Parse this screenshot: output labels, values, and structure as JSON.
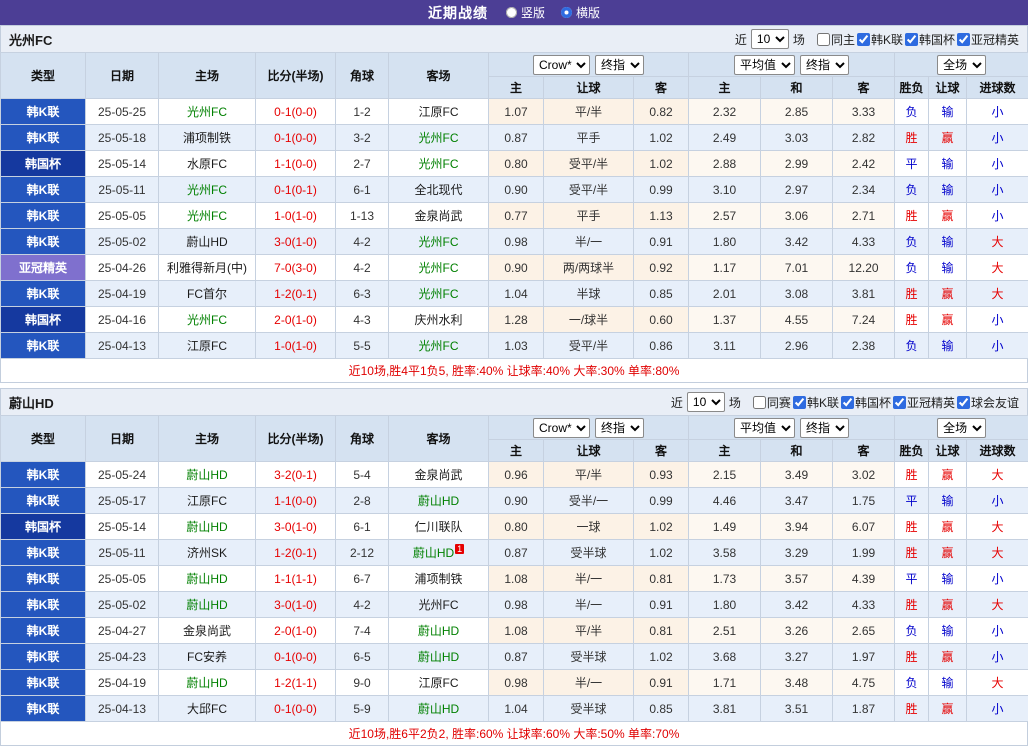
{
  "top_bar": {
    "title": "近期战绩",
    "radio_vertical": "竖版",
    "radio_horizontal": "横版",
    "selected": "横版"
  },
  "labels": {
    "near": "近",
    "count": "10",
    "matches": "场"
  },
  "table_header": {
    "col_type": "类型",
    "col_date": "日期",
    "col_home": "主场",
    "col_score": "比分(半场)",
    "col_corner": "角球",
    "col_away": "客场",
    "odds_source_select": "Crow*",
    "odds_time_select": "终指",
    "avg_select": "平均值",
    "avg_time_select": "终指",
    "scope_select": "全场",
    "sub_home": "主",
    "sub_handicap": "让球",
    "sub_away": "客",
    "sub_avg_home": "主",
    "sub_avg_draw": "和",
    "sub_avg_away": "客",
    "sub_result": "胜负",
    "sub_handicap_result": "让球",
    "sub_goals": "进球数"
  },
  "type_colors": {
    "韩K联": "#2456be",
    "韩国杯": "#15399f",
    "亚冠精英": "#7f70ce"
  },
  "colors": {
    "topbar": "#4c3e95",
    "subject_team": "#008000",
    "score": "#e60000",
    "win_text": "#e60000",
    "loss_text": "#0000cc"
  },
  "sections": [
    {
      "team": "光州FC",
      "filters": [
        {
          "label": "同主",
          "checked": false
        },
        {
          "label": "韩K联",
          "checked": true
        },
        {
          "label": "韩国杯",
          "checked": true
        },
        {
          "label": "亚冠精英",
          "checked": true
        }
      ],
      "rows": [
        {
          "type": "韩K联",
          "date": "25-05-25",
          "home": "光州FC",
          "home_subject": true,
          "score": "0-1(0-0)",
          "corner": "1-2",
          "away": "江原FC",
          "odds": [
            "1.07",
            "平/半",
            "0.82"
          ],
          "avg": [
            "2.32",
            "2.85",
            "3.33"
          ],
          "result": [
            "负",
            "输",
            "小"
          ]
        },
        {
          "type": "韩K联",
          "date": "25-05-18",
          "home": "浦项制铁",
          "score": "0-1(0-0)",
          "corner": "3-2",
          "away": "光州FC",
          "away_subject": true,
          "odds": [
            "0.87",
            "平手",
            "1.02"
          ],
          "avg": [
            "2.49",
            "3.03",
            "2.82"
          ],
          "result": [
            "胜",
            "赢",
            "小"
          ]
        },
        {
          "type": "韩国杯",
          "date": "25-05-14",
          "home": "水原FC",
          "score": "1-1(0-0)",
          "corner": "2-7",
          "away": "光州FC",
          "away_subject": true,
          "odds": [
            "0.80",
            "受平/半",
            "1.02"
          ],
          "avg": [
            "2.88",
            "2.99",
            "2.42"
          ],
          "result": [
            "平",
            "输",
            "小"
          ]
        },
        {
          "type": "韩K联",
          "date": "25-05-11",
          "home": "光州FC",
          "home_subject": true,
          "score": "0-1(0-1)",
          "corner": "6-1",
          "away": "全北现代",
          "odds": [
            "0.90",
            "受平/半",
            "0.99"
          ],
          "avg": [
            "3.10",
            "2.97",
            "2.34"
          ],
          "result": [
            "负",
            "输",
            "小"
          ]
        },
        {
          "type": "韩K联",
          "date": "25-05-05",
          "home": "光州FC",
          "home_subject": true,
          "score": "1-0(1-0)",
          "corner": "1-13",
          "away": "金泉尚武",
          "odds": [
            "0.77",
            "平手",
            "1.13"
          ],
          "avg": [
            "2.57",
            "3.06",
            "2.71"
          ],
          "result": [
            "胜",
            "赢",
            "小"
          ]
        },
        {
          "type": "韩K联",
          "date": "25-05-02",
          "home": "蔚山HD",
          "score": "3-0(1-0)",
          "corner": "4-2",
          "away": "光州FC",
          "away_subject": true,
          "odds": [
            "0.98",
            "半/一",
            "0.91"
          ],
          "avg": [
            "1.80",
            "3.42",
            "4.33"
          ],
          "result": [
            "负",
            "输",
            "大"
          ]
        },
        {
          "type": "亚冠精英",
          "date": "25-04-26",
          "home": "利雅得新月(中)",
          "score": "7-0(3-0)",
          "corner": "4-2",
          "away": "光州FC",
          "away_subject": true,
          "odds": [
            "0.90",
            "两/两球半",
            "0.92"
          ],
          "avg": [
            "1.17",
            "7.01",
            "12.20"
          ],
          "result": [
            "负",
            "输",
            "大"
          ]
        },
        {
          "type": "韩K联",
          "date": "25-04-19",
          "home": "FC首尔",
          "score": "1-2(0-1)",
          "corner": "6-3",
          "away": "光州FC",
          "away_subject": true,
          "odds": [
            "1.04",
            "半球",
            "0.85"
          ],
          "avg": [
            "2.01",
            "3.08",
            "3.81"
          ],
          "result": [
            "胜",
            "赢",
            "大"
          ]
        },
        {
          "type": "韩国杯",
          "date": "25-04-16",
          "home": "光州FC",
          "home_subject": true,
          "score": "2-0(1-0)",
          "corner": "4-3",
          "away": "庆州水利",
          "odds": [
            "1.28",
            "一/球半",
            "0.60"
          ],
          "avg": [
            "1.37",
            "4.55",
            "7.24"
          ],
          "result": [
            "胜",
            "赢",
            "小"
          ]
        },
        {
          "type": "韩K联",
          "date": "25-04-13",
          "home": "江原FC",
          "score": "1-0(1-0)",
          "corner": "5-5",
          "away": "光州FC",
          "away_subject": true,
          "odds": [
            "1.03",
            "受平/半",
            "0.86"
          ],
          "avg": [
            "3.11",
            "2.96",
            "2.38"
          ],
          "result": [
            "负",
            "输",
            "小"
          ]
        }
      ],
      "summary": "近10场,胜4平1负5, 胜率:40% 让球率:40% 大率:30% 单率:80%"
    },
    {
      "team": "蔚山HD",
      "filters": [
        {
          "label": "同赛",
          "checked": false
        },
        {
          "label": "韩K联",
          "checked": true
        },
        {
          "label": "韩国杯",
          "checked": true
        },
        {
          "label": "亚冠精英",
          "checked": true
        },
        {
          "label": "球会友谊",
          "checked": true
        }
      ],
      "rows": [
        {
          "type": "韩K联",
          "date": "25-05-24",
          "home": "蔚山HD",
          "home_subject": true,
          "score": "3-2(0-1)",
          "corner": "5-4",
          "away": "金泉尚武",
          "odds": [
            "0.96",
            "平/半",
            "0.93"
          ],
          "avg": [
            "2.15",
            "3.49",
            "3.02"
          ],
          "result": [
            "胜",
            "赢",
            "大"
          ]
        },
        {
          "type": "韩K联",
          "date": "25-05-17",
          "home": "江原FC",
          "score": "1-1(0-0)",
          "corner": "2-8",
          "away": "蔚山HD",
          "away_subject": true,
          "odds": [
            "0.90",
            "受半/一",
            "0.99"
          ],
          "avg": [
            "4.46",
            "3.47",
            "1.75"
          ],
          "result": [
            "平",
            "输",
            "小"
          ]
        },
        {
          "type": "韩国杯",
          "date": "25-05-14",
          "home": "蔚山HD",
          "home_subject": true,
          "score": "3-0(1-0)",
          "corner": "6-1",
          "away": "仁川联队",
          "odds": [
            "0.80",
            "一球",
            "1.02"
          ],
          "avg": [
            "1.49",
            "3.94",
            "6.07"
          ],
          "result": [
            "胜",
            "赢",
            "大"
          ]
        },
        {
          "type": "韩K联",
          "date": "25-05-11",
          "home": "济州SK",
          "score": "1-2(0-1)",
          "corner": "2-12",
          "away": "蔚山HD",
          "away_subject": true,
          "away_badge": "1",
          "odds": [
            "0.87",
            "受半球",
            "1.02"
          ],
          "avg": [
            "3.58",
            "3.29",
            "1.99"
          ],
          "result": [
            "胜",
            "赢",
            "大"
          ]
        },
        {
          "type": "韩K联",
          "date": "25-05-05",
          "home": "蔚山HD",
          "home_subject": true,
          "score": "1-1(1-1)",
          "corner": "6-7",
          "away": "浦项制铁",
          "odds": [
            "1.08",
            "半/一",
            "0.81"
          ],
          "avg": [
            "1.73",
            "3.57",
            "4.39"
          ],
          "result": [
            "平",
            "输",
            "小"
          ]
        },
        {
          "type": "韩K联",
          "date": "25-05-02",
          "home": "蔚山HD",
          "home_subject": true,
          "score": "3-0(1-0)",
          "corner": "4-2",
          "away": "光州FC",
          "odds": [
            "0.98",
            "半/一",
            "0.91"
          ],
          "avg": [
            "1.80",
            "3.42",
            "4.33"
          ],
          "result": [
            "胜",
            "赢",
            "大"
          ]
        },
        {
          "type": "韩K联",
          "date": "25-04-27",
          "home": "金泉尚武",
          "score": "2-0(1-0)",
          "corner": "7-4",
          "away": "蔚山HD",
          "away_subject": true,
          "odds": [
            "1.08",
            "平/半",
            "0.81"
          ],
          "avg": [
            "2.51",
            "3.26",
            "2.65"
          ],
          "result": [
            "负",
            "输",
            "小"
          ]
        },
        {
          "type": "韩K联",
          "date": "25-04-23",
          "home": "FC安养",
          "score": "0-1(0-0)",
          "corner": "6-5",
          "away": "蔚山HD",
          "away_subject": true,
          "odds": [
            "0.87",
            "受半球",
            "1.02"
          ],
          "avg": [
            "3.68",
            "3.27",
            "1.97"
          ],
          "result": [
            "胜",
            "赢",
            "小"
          ]
        },
        {
          "type": "韩K联",
          "date": "25-04-19",
          "home": "蔚山HD",
          "home_subject": true,
          "score": "1-2(1-1)",
          "corner": "9-0",
          "away": "江原FC",
          "odds": [
            "0.98",
            "半/一",
            "0.91"
          ],
          "avg": [
            "1.71",
            "3.48",
            "4.75"
          ],
          "result": [
            "负",
            "输",
            "大"
          ]
        },
        {
          "type": "韩K联",
          "date": "25-04-13",
          "home": "大邱FC",
          "score": "0-1(0-0)",
          "corner": "5-9",
          "away": "蔚山HD",
          "away_subject": true,
          "odds": [
            "1.04",
            "受半球",
            "0.85"
          ],
          "avg": [
            "3.81",
            "3.51",
            "1.87"
          ],
          "result": [
            "胜",
            "赢",
            "小"
          ]
        }
      ],
      "summary": "近10场,胜6平2负2, 胜率:60% 让球率:60% 大率:50% 单率:70%"
    }
  ]
}
